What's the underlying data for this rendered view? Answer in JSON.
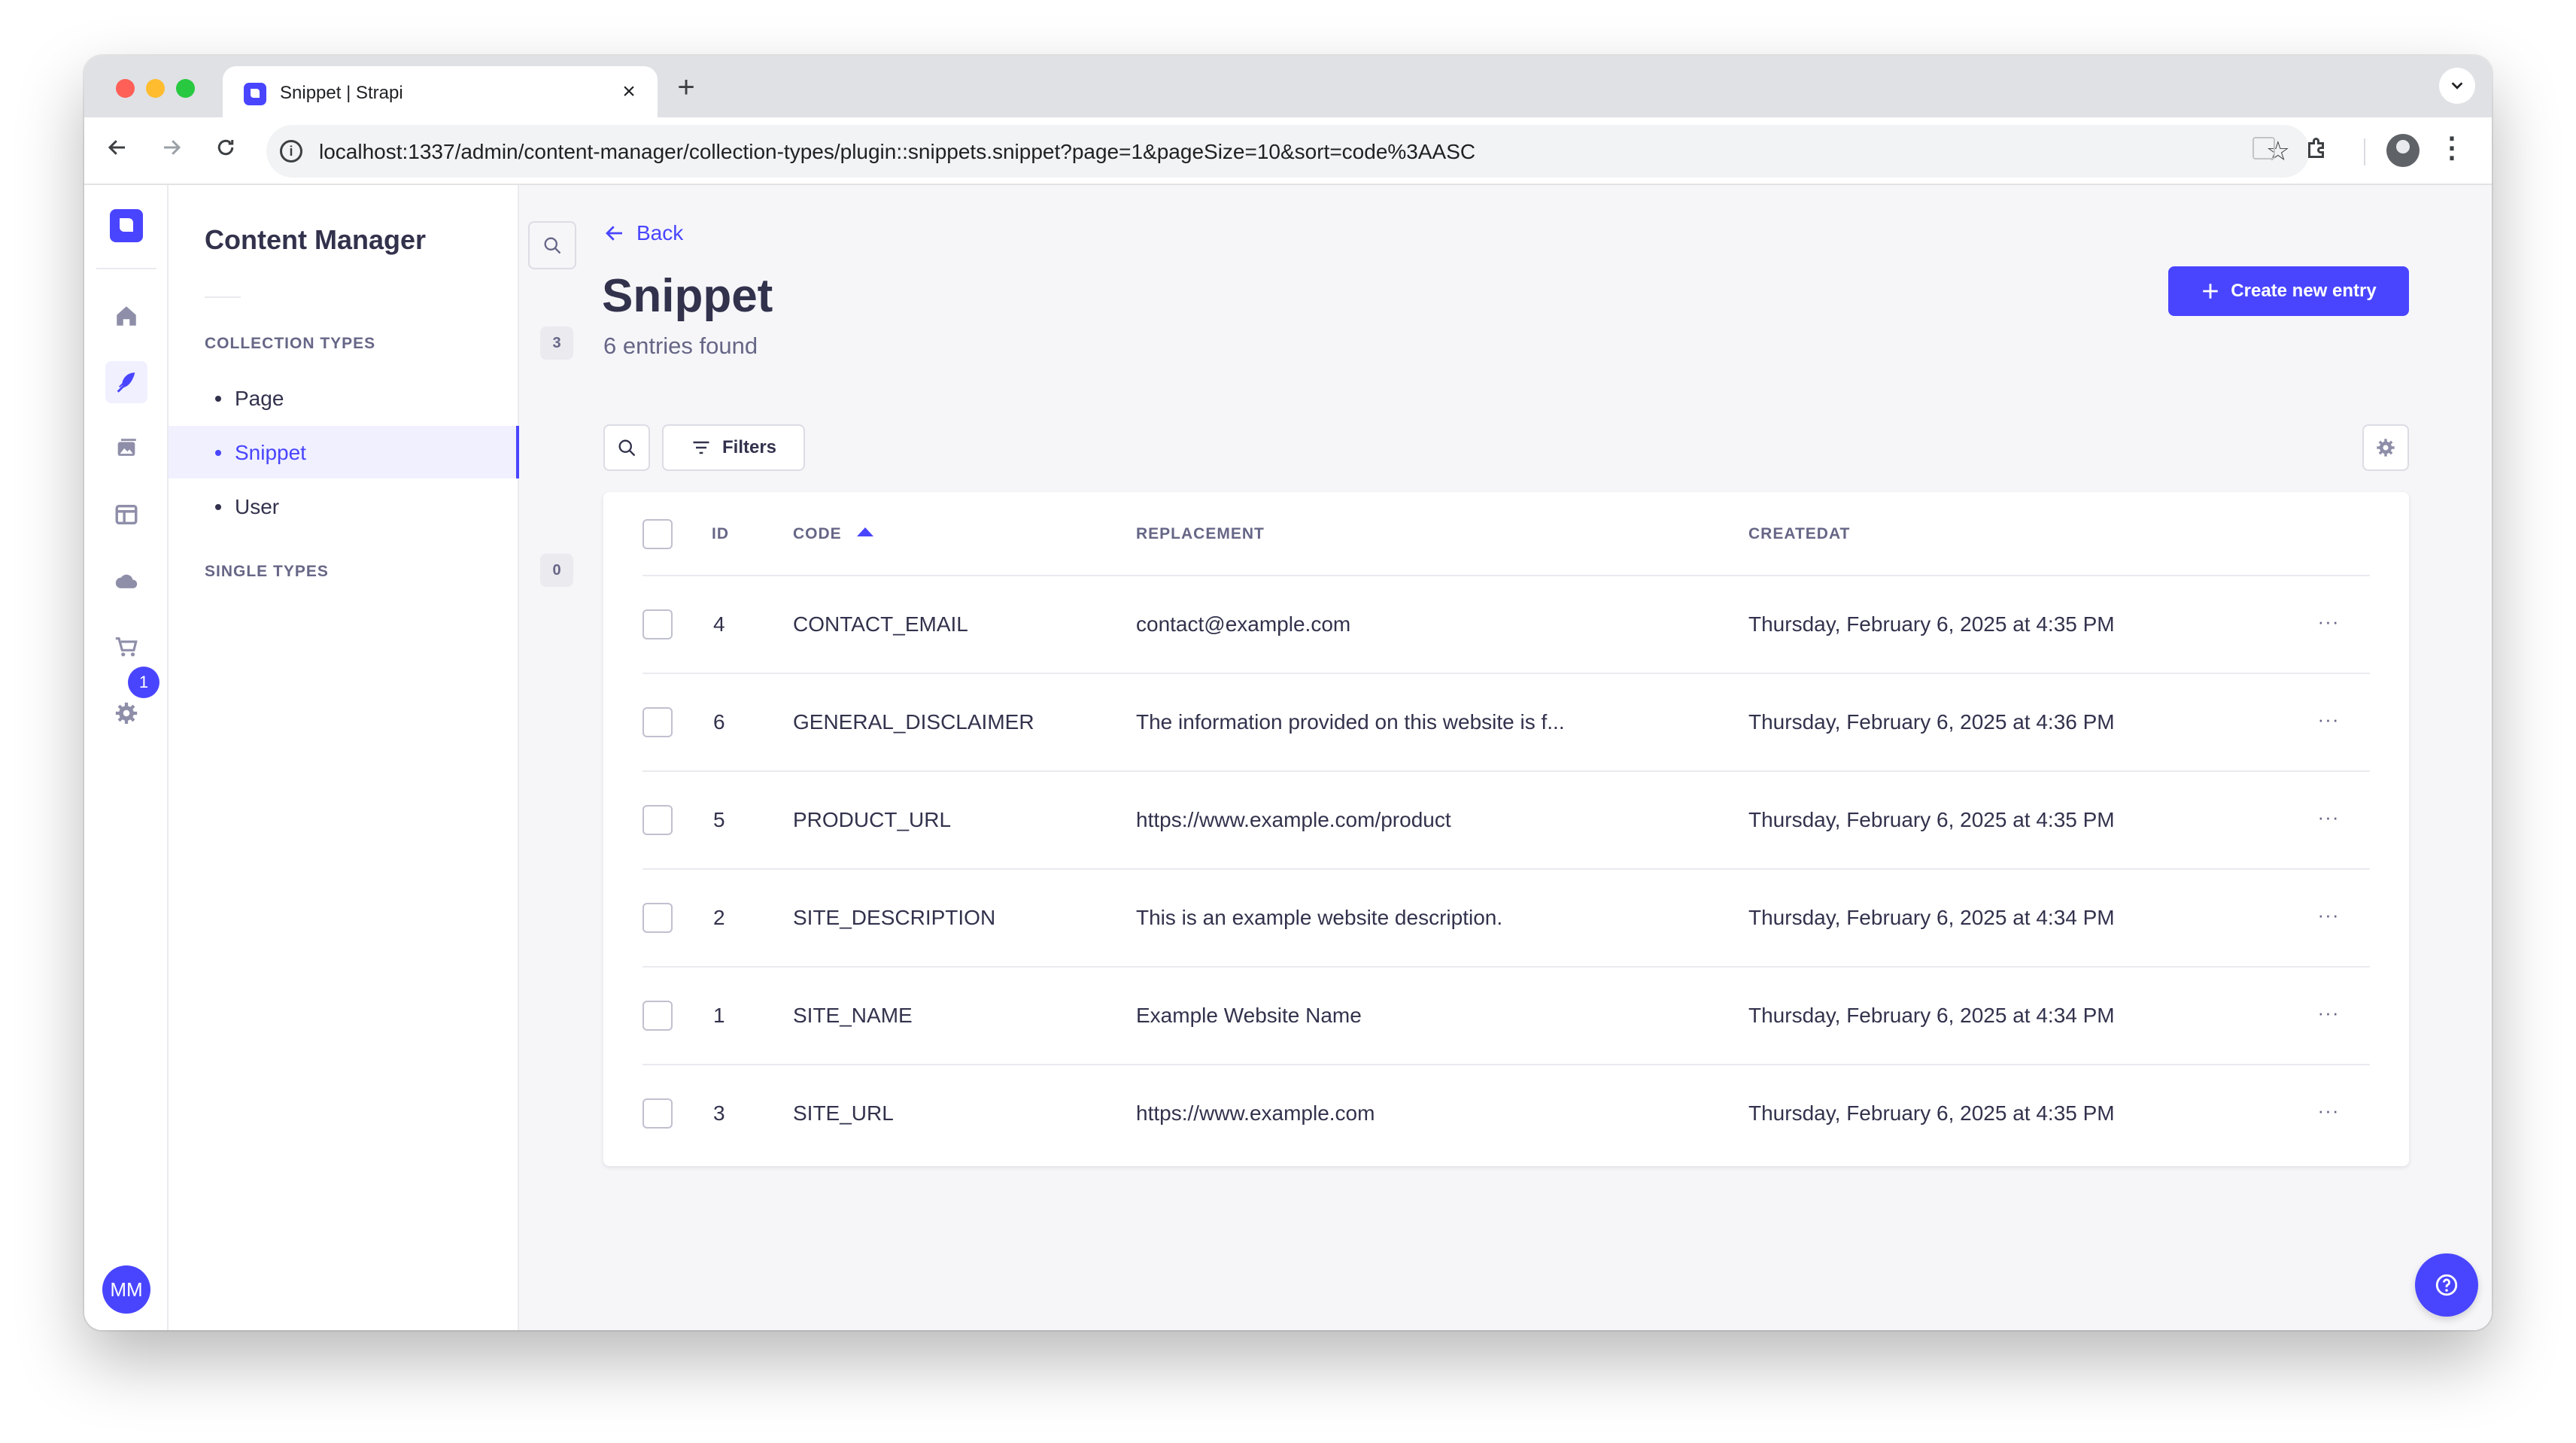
{
  "browser": {
    "tab_title": "Snippet | Strapi",
    "tab_close": "×",
    "new_tab": "+",
    "url": "localhost:1337/admin/content-manager/collection-types/plugin::snippets.snippet?page=1&pageSize=10&sort=code%3AASC"
  },
  "sidebar": {
    "title": "Content Manager",
    "collection_types_label": "COLLECTION TYPES",
    "collection_types_count": "3",
    "collection_items": [
      {
        "label": "Page",
        "active": false
      },
      {
        "label": "Snippet",
        "active": true
      },
      {
        "label": "User",
        "active": false
      }
    ],
    "single_types_label": "SINGLE TYPES",
    "single_types_count": "0"
  },
  "mainnav": {
    "settings_badge": "1",
    "avatar_initials": "MM"
  },
  "header": {
    "back_label": "Back",
    "title": "Snippet",
    "subtitle": "6 entries found",
    "create_label": "Create new entry"
  },
  "toolbar": {
    "filters_label": "Filters"
  },
  "table": {
    "columns": {
      "id": "ID",
      "code": "CODE",
      "replacement": "REPLACEMENT",
      "createdat": "CREATEDAT"
    },
    "rows": [
      {
        "id": "4",
        "code": "CONTACT_EMAIL",
        "replacement": "contact@example.com",
        "createdat": "Thursday, February 6, 2025 at 4:35 PM"
      },
      {
        "id": "6",
        "code": "GENERAL_DISCLAIMER",
        "replacement": "The information provided on this website is f...",
        "createdat": "Thursday, February 6, 2025 at 4:36 PM"
      },
      {
        "id": "5",
        "code": "PRODUCT_URL",
        "replacement": "https://www.example.com/product",
        "createdat": "Thursday, February 6, 2025 at 4:35 PM"
      },
      {
        "id": "2",
        "code": "SITE_DESCRIPTION",
        "replacement": "This is an example website description.",
        "createdat": "Thursday, February 6, 2025 at 4:34 PM"
      },
      {
        "id": "1",
        "code": "SITE_NAME",
        "replacement": "Example Website Name",
        "createdat": "Thursday, February 6, 2025 at 4:34 PM"
      },
      {
        "id": "3",
        "code": "SITE_URL",
        "replacement": "https://www.example.com",
        "createdat": "Thursday, February 6, 2025 at 4:35 PM"
      }
    ],
    "row_action_label": "···"
  }
}
